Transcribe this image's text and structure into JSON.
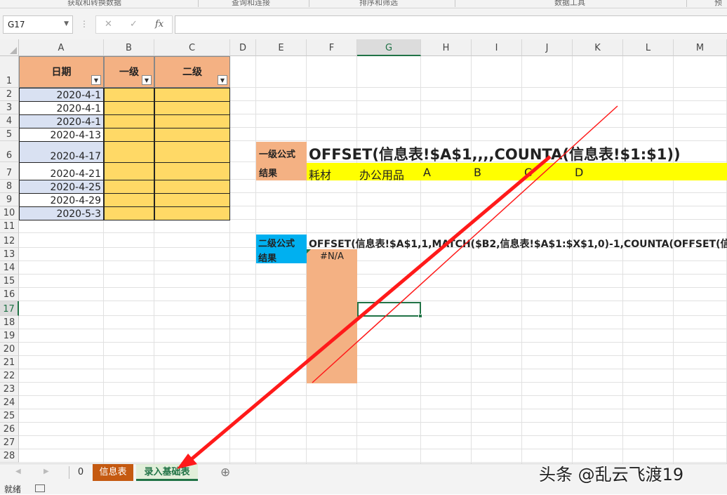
{
  "ribbon": {
    "groups": [
      "获取和转换数据",
      "查询和连接",
      "排序和筛选",
      "数据工具",
      "预"
    ]
  },
  "formula_bar": {
    "name_box": "G17",
    "cancel_icon": "✕",
    "enter_icon": "✓",
    "fx_label": "fx",
    "formula": ""
  },
  "columns": [
    "A",
    "B",
    "C",
    "D",
    "E",
    "F",
    "G",
    "H",
    "I",
    "J",
    "K",
    "L",
    "M"
  ],
  "selected_column": "G",
  "rows": [
    "1",
    "2",
    "3",
    "4",
    "5",
    "6",
    "7",
    "8",
    "9",
    "10",
    "11",
    "12",
    "13",
    "14",
    "15",
    "16",
    "17",
    "18",
    "19",
    "20",
    "21",
    "22",
    "23",
    "24",
    "25",
    "26",
    "27",
    "28"
  ],
  "selected_row": "17",
  "table": {
    "headers": [
      "日期",
      "一级",
      "二级"
    ],
    "dates": [
      "2020-4-1",
      "2020-4-1",
      "2020-4-1",
      "2020-4-13",
      "2020-4-17",
      "2020-4-21",
      "2020-4-25",
      "2020-4-29",
      "2020-5-3"
    ]
  },
  "level1": {
    "formula_label": "一级公式",
    "result_label": "结果",
    "formula": "OFFSET(信息表!$A$1,,,,COUNTA(信息表!$1:$1))",
    "results": [
      "耗材",
      "办公用品",
      "A",
      "B",
      "C",
      "D"
    ]
  },
  "level2": {
    "formula_label": "二级公式",
    "result_label": "结果",
    "formula": "OFFSET(信息表!$A$1,1,MATCH($B2,信息表!$A$1:$X$1,0)-1,COUNTA(OFFSET(信",
    "result": "#N/A"
  },
  "sheet_tabs": [
    "0",
    "信息表",
    "录入基础表"
  ],
  "active_tab": "录入基础表",
  "add_sheet_icon": "⊕",
  "status": {
    "ready": "就绪"
  },
  "watermark": "头条 @乱云飞渡19",
  "colors": {
    "header_orange": "#f4b183",
    "yellow_cells": "#ffd966",
    "bright_yellow": "#ffff00",
    "blue_label": "#00b0f0",
    "date_blue": "#d9e1f2",
    "tab_orange": "#c55a11",
    "tab_green": "#217346",
    "arrow_red": "#ff1a1a"
  }
}
